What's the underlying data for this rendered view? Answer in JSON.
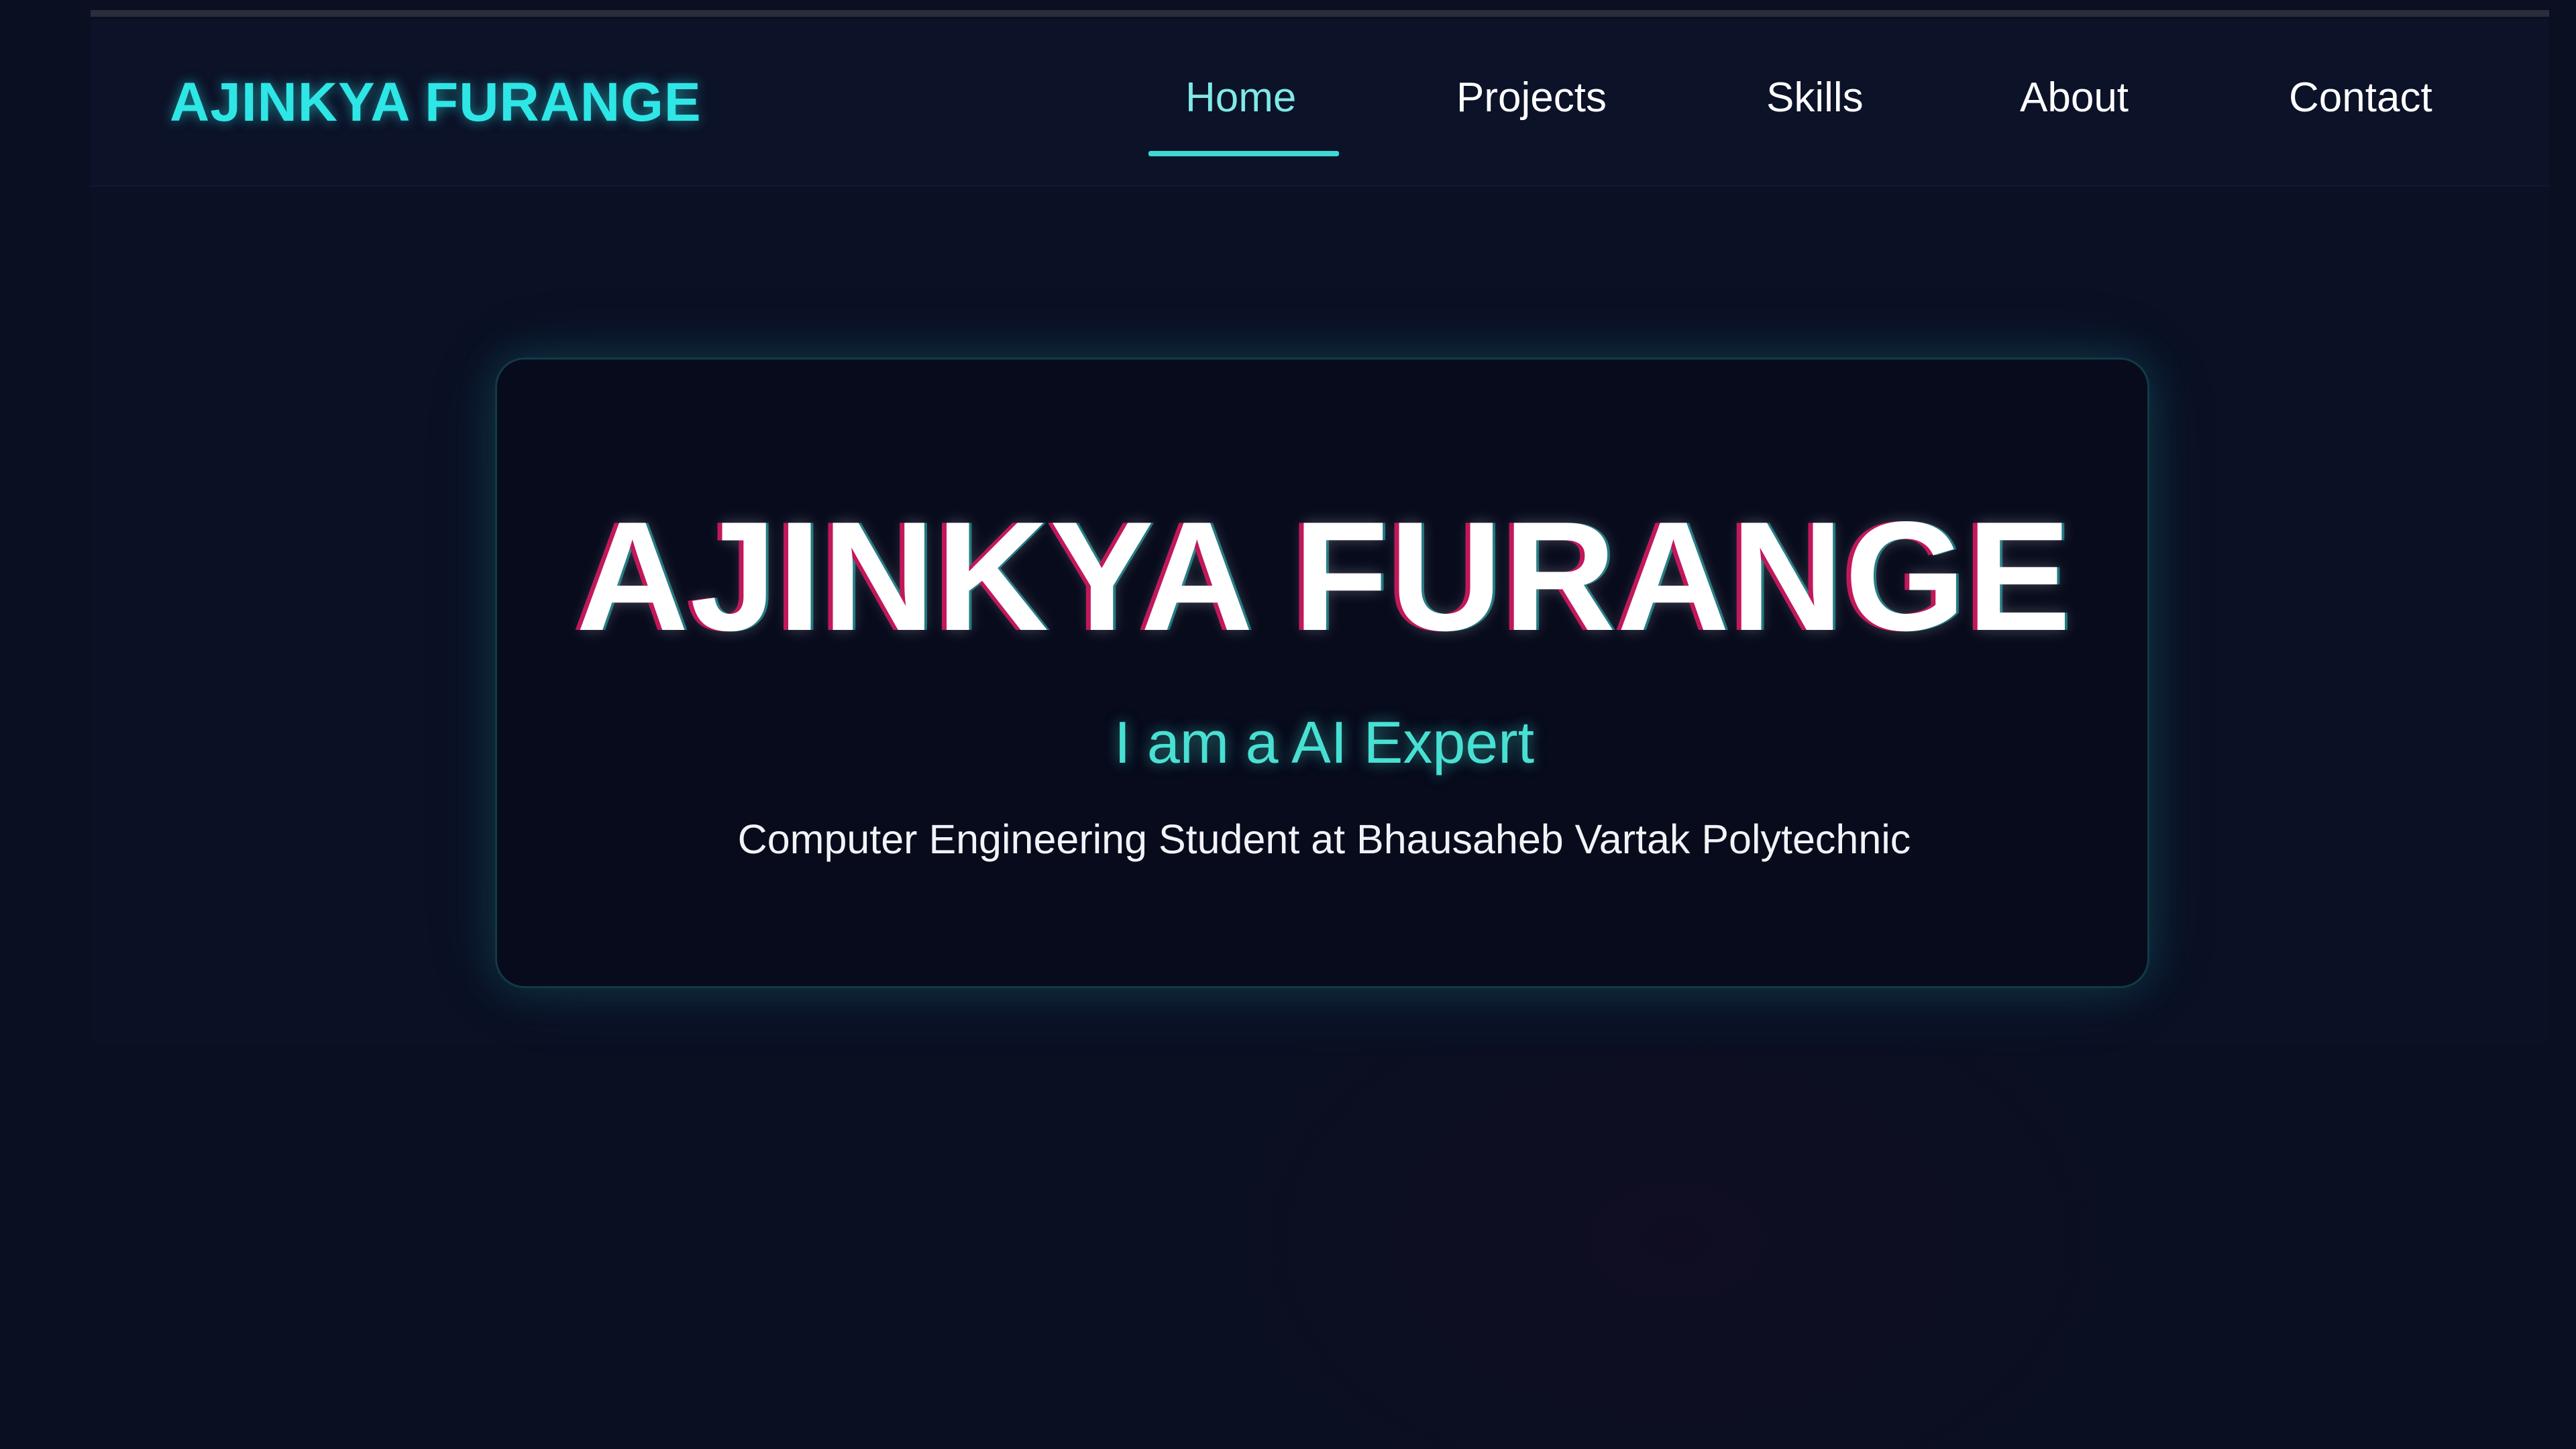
{
  "navbar": {
    "logo": "AJINKYA FURANGE",
    "links": [
      "Home",
      "Projects",
      "Skills",
      "About",
      "Contact"
    ],
    "active_link": "Home"
  },
  "hero": {
    "title": "AJINKYA FURANGE",
    "subtitle": "I am a AI Expert",
    "description": "Computer Engineering Student at Bhausaheb Vartak Polytechnic"
  },
  "colors": {
    "background": "#0a0f22",
    "accent_cyan": "#2ee6e6",
    "title_shadow_magenta": "#c2185b",
    "subtitle": "#48e0d2"
  }
}
